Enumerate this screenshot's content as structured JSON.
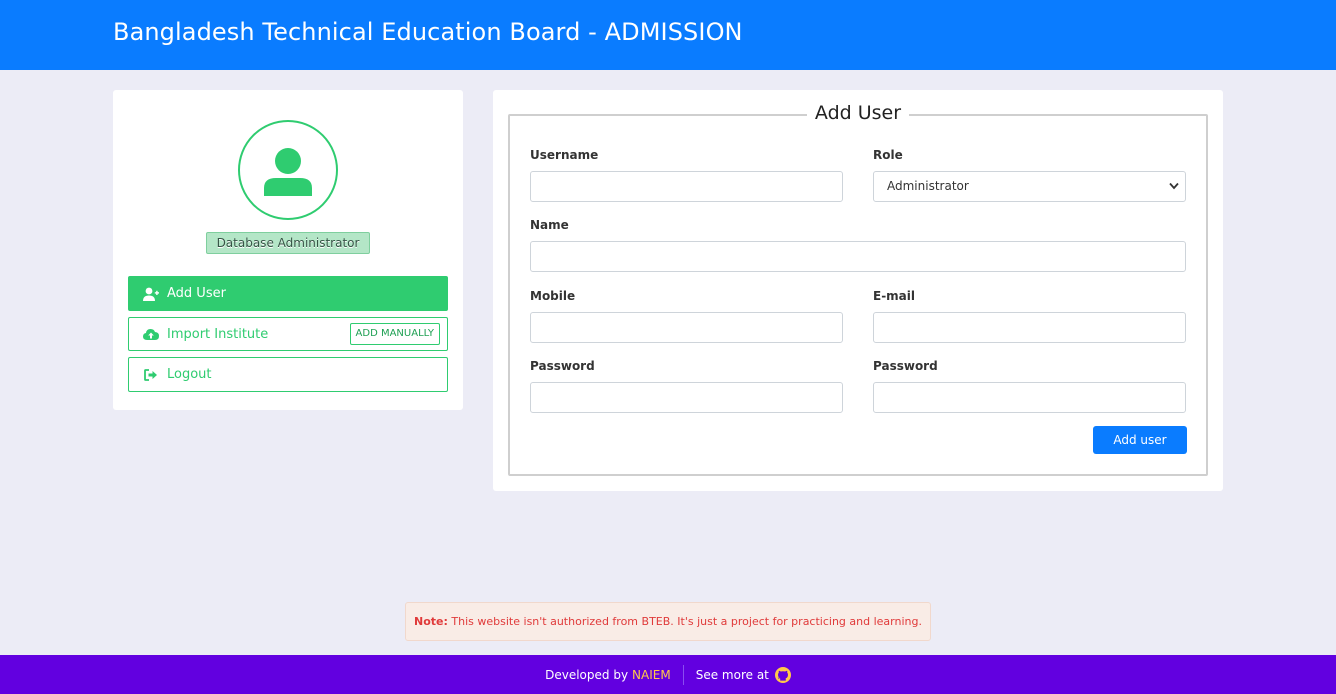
{
  "header": {
    "title": "Bangladesh Technical Education Board - ADMISSION"
  },
  "sidebar": {
    "role_badge": "Database Administrator",
    "nav": [
      {
        "label": "Add User",
        "icon": "user-plus-icon",
        "active": true
      },
      {
        "label": "Import Institute",
        "icon": "cloud-upload-icon",
        "action": "ADD MANUALLY"
      },
      {
        "label": "Logout",
        "icon": "sign-out-icon"
      }
    ]
  },
  "form": {
    "title": "Add User",
    "username_label": "Username",
    "role_label": "Role",
    "role_value": "Administrator",
    "name_label": "Name",
    "mobile_label": "Mobile",
    "email_label": "E-mail",
    "password_label": "Password",
    "confirm_password_label": "Password",
    "submit_label": "Add user"
  },
  "note": {
    "prefix": "Note:",
    "text": "This website isn't authorized from BTEB. It's just a project for practicing and learning."
  },
  "footer": {
    "developed_by": "Developed by",
    "developer": "NAIEM",
    "see_more": "See more at"
  },
  "colors": {
    "primary": "#0a7cff",
    "success": "#2fcc70",
    "footer": "#6200e0",
    "accent": "#ffc84a",
    "danger": "#e03a3a"
  }
}
